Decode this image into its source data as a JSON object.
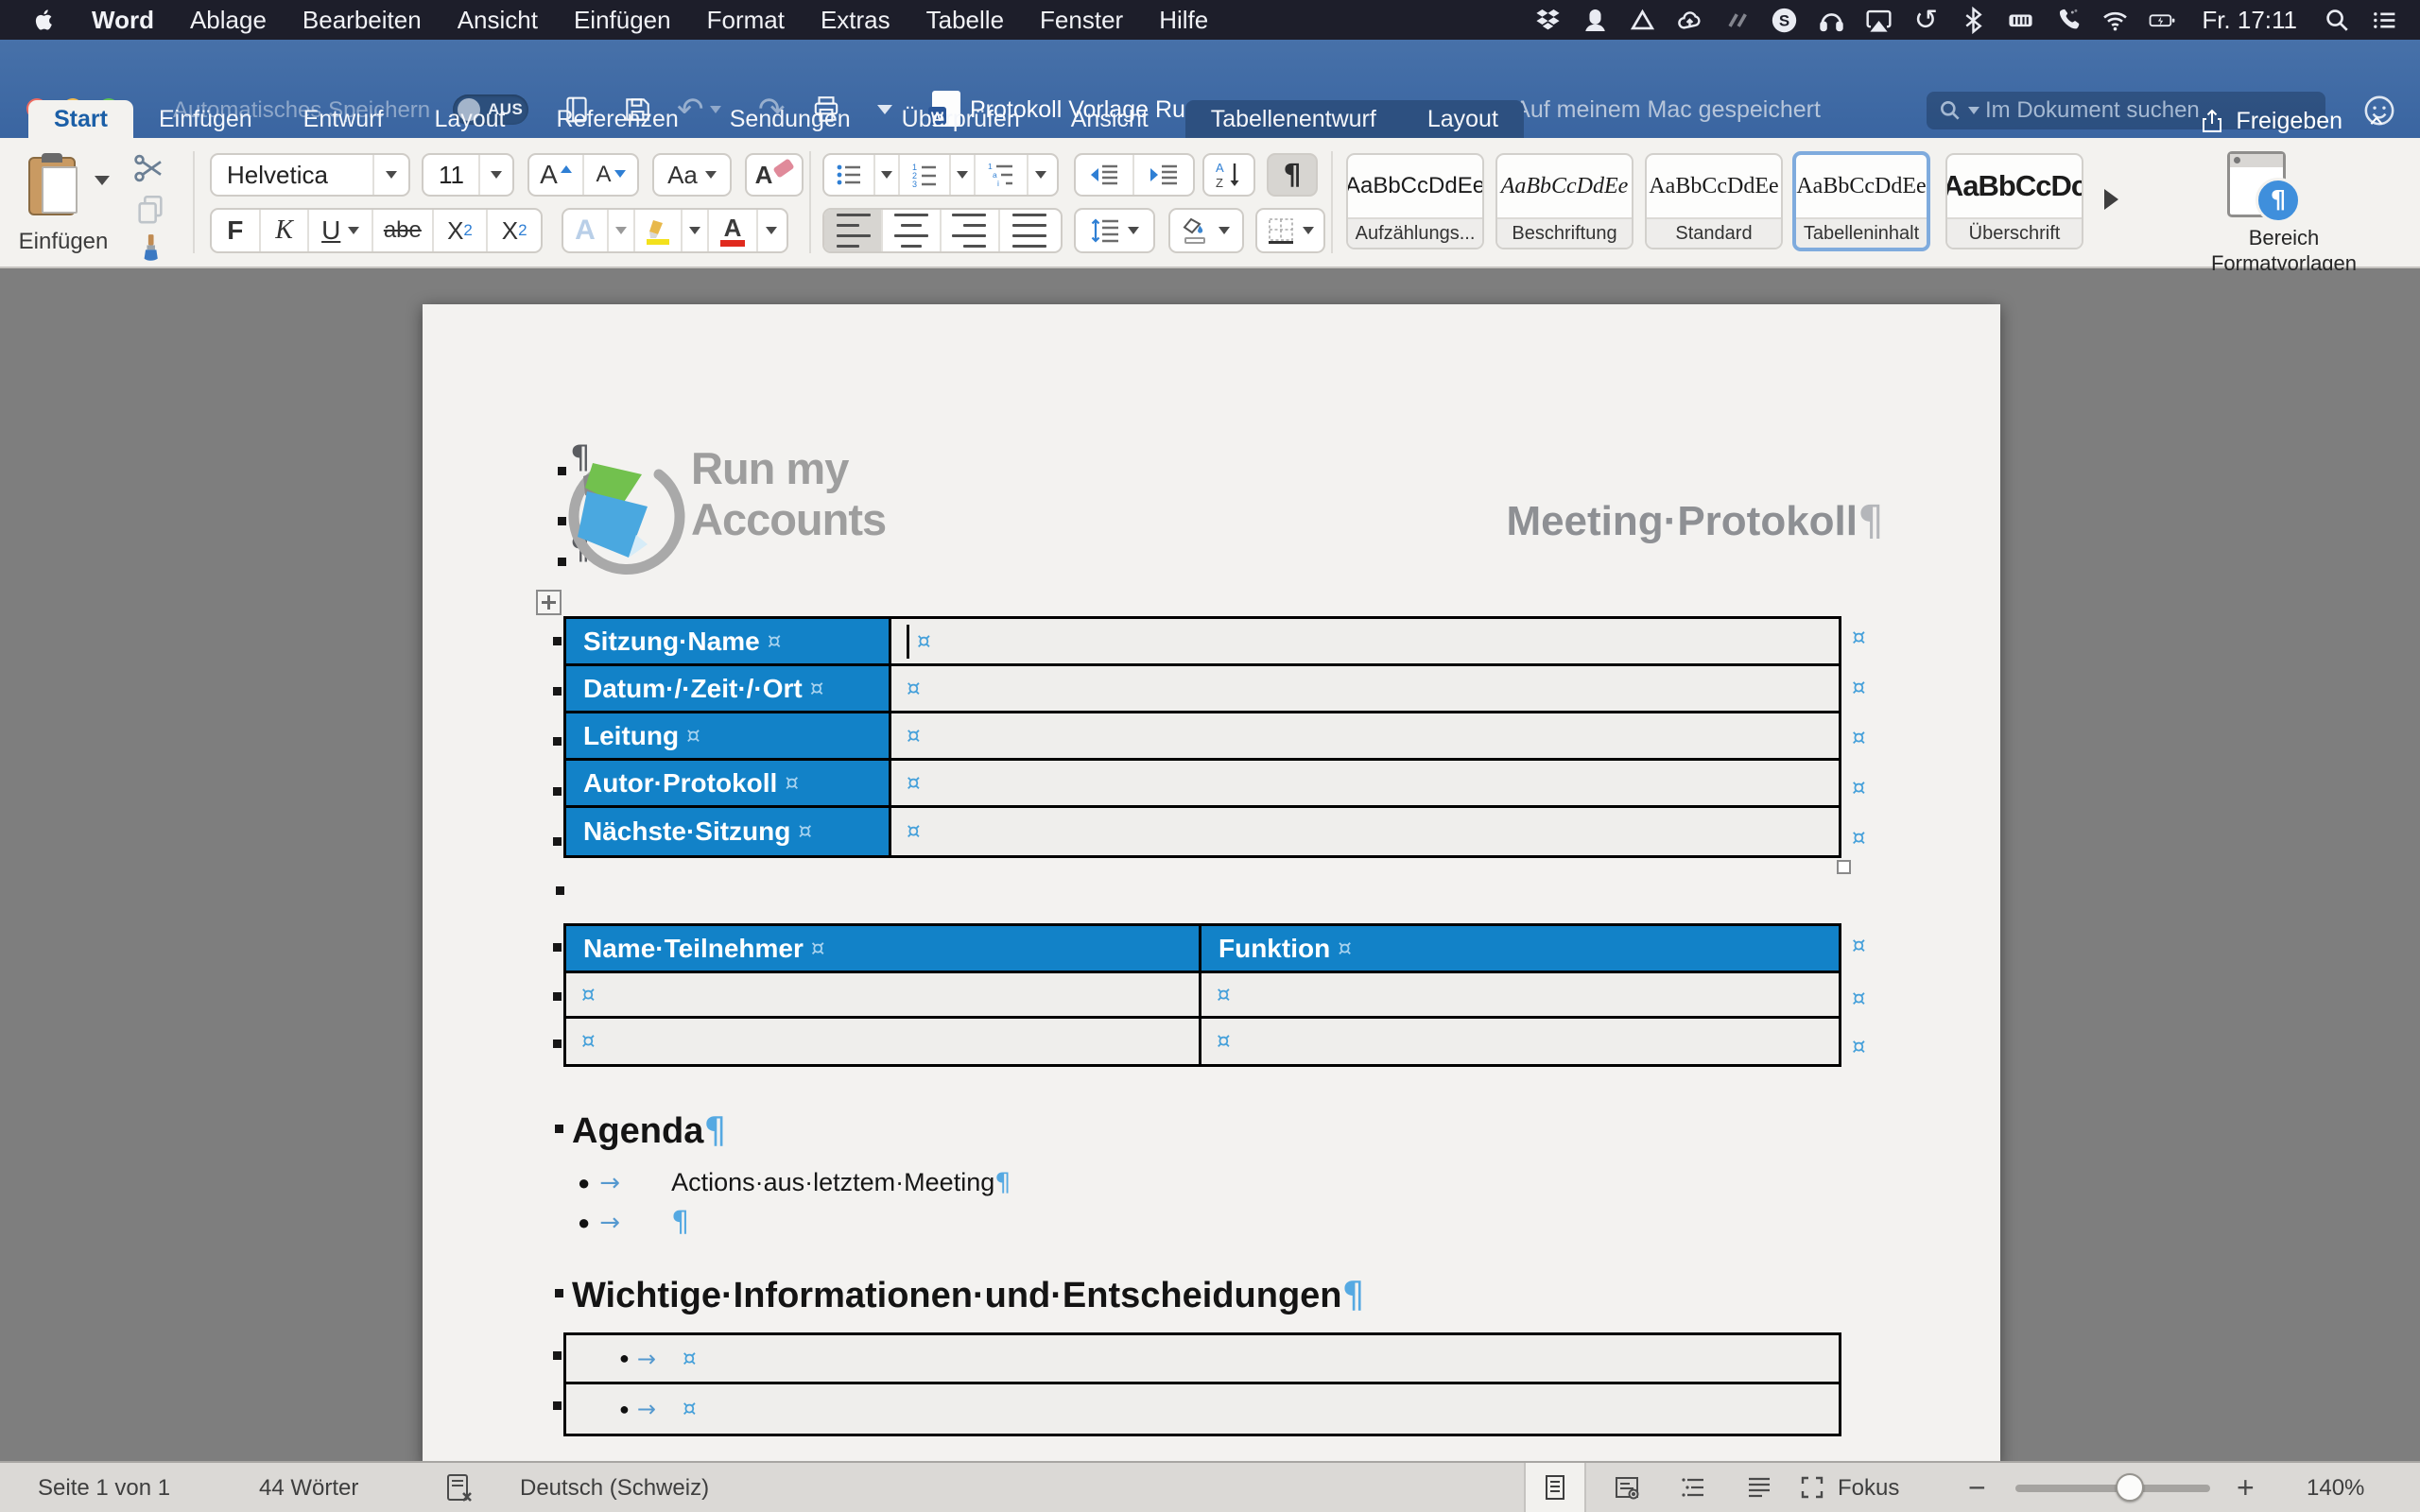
{
  "menu_bar": {
    "clock": "Fr. 17:11",
    "items": [
      "Word",
      "Ablage",
      "Bearbeiten",
      "Ansicht",
      "Einfügen",
      "Format",
      "Extras",
      "Tabelle",
      "Fenster",
      "Hilfe"
    ]
  },
  "title_bar": {
    "autosave_label": "Automatisches Speichern",
    "autosave_state": "AUS",
    "doc_title": "Protokoll Vorlage Run my Accounts  -  Kompatibi...",
    "doc_location": "– Auf meinem Mac gespeichert",
    "search_placeholder": "Im Dokument suchen"
  },
  "ribbon_tabs": {
    "items": [
      "Start",
      "Einfügen",
      "Entwurf",
      "Layout",
      "Referenzen",
      "Sendungen",
      "Überprüfen",
      "Ansicht"
    ],
    "contextual": [
      "Tabellenentwurf",
      "Layout"
    ],
    "share_label": "Freigeben"
  },
  "ribbon": {
    "paste_label": "Einfügen",
    "font_name": "Helvetica",
    "font_size": "11",
    "bold": "F",
    "italic": "K",
    "underline": "U",
    "strikethrough": "abe",
    "sub_base": "X",
    "sub_small": "2",
    "sup_base": "X",
    "sup_small": "2",
    "case_label": "Aa",
    "effects_label": "A",
    "font_color_label": "A",
    "pilcrow": "¶",
    "styles": [
      {
        "sample": "AaBbCcDdEe",
        "label": "Aufzählungs..."
      },
      {
        "sample": "AaBbCcDdEe",
        "label": "Beschriftung"
      },
      {
        "sample": "AaBbCcDdEe",
        "label": "Standard"
      },
      {
        "sample": "AaBbCcDdEe",
        "label": "Tabelleninhalt"
      },
      {
        "sample": "AaBbCcDc",
        "label": "Überschrift"
      }
    ],
    "styles_pane_line1": "Bereich",
    "styles_pane_line2": "Formatvorlagen"
  },
  "document": {
    "logo_line1": "Run my",
    "logo_line2": "Accounts",
    "page_title": "Meeting·Protokoll",
    "info_rows": [
      "Sitzung·Name",
      "Datum·/·Zeit·/·Ort",
      "Leitung",
      "Autor·Protokoll",
      "Nächste·Sitzung"
    ],
    "participants_headers": [
      "Name·Teilnehmer",
      "Funktion"
    ],
    "agenda_heading": "Agenda",
    "agenda_item": "Actions·aus·letztem·Meeting",
    "decisions_heading": "Wichtige·Informationen·und·Entscheidungen",
    "pilcrow": "¶",
    "bullet": "●",
    "tab_arrow": "→",
    "cell_mark": "¤",
    "square_mark": "▪"
  },
  "status_bar": {
    "page_count": "Seite 1 von 1",
    "word_count": "44 Wörter",
    "language": "Deutsch (Schweiz)",
    "focus_label": "Fokus",
    "zoom_level": "140%"
  },
  "colors": {
    "chrome_blue": "#3e69a4",
    "table_blue": "#1282c8",
    "marker_blue": "#45a0da",
    "menubar_dark": "#1d1e2a"
  }
}
